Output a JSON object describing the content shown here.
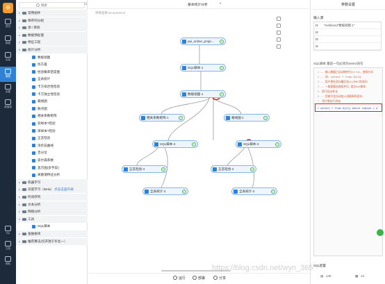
{
  "rail": [
    {
      "label": "首页"
    },
    {
      "label": "数据"
    },
    {
      "label": "实验"
    },
    {
      "label": "模型"
    },
    {
      "label": "设置"
    },
    {
      "label": "数据源"
    },
    {
      "label": "PAI"
    },
    {
      "label": "文档"
    },
    {
      "label": "帮助"
    }
  ],
  "tree": {
    "search_placeholder": "搜索",
    "rows": [
      {
        "type": "group",
        "label": "常用组件"
      },
      {
        "type": "group",
        "label": "保存的分组"
      },
      {
        "type": "group",
        "label": "源 / 目标"
      },
      {
        "type": "group",
        "label": "数据预处理"
      },
      {
        "type": "group",
        "label": "特征工程"
      },
      {
        "type": "group-open",
        "label": "统计分析"
      },
      {
        "type": "leaf",
        "label": "数据视图"
      },
      {
        "type": "leaf",
        "label": "协方差"
      },
      {
        "type": "leaf",
        "label": "经验概率密度图"
      },
      {
        "type": "leaf",
        "label": "全表统计"
      },
      {
        "type": "leaf",
        "label": "卡方拟合性检验"
      },
      {
        "type": "leaf",
        "label": "卡方独立性检验"
      },
      {
        "type": "leaf",
        "label": "箱线图"
      },
      {
        "type": "leaf",
        "label": "散点图"
      },
      {
        "type": "leaf",
        "label": "相关系数矩阵"
      },
      {
        "type": "leaf",
        "label": "双样本T检验"
      },
      {
        "type": "leaf",
        "label": "单样本T检验"
      },
      {
        "type": "leaf",
        "label": "正态检验"
      },
      {
        "type": "leaf",
        "label": "洛伦兹曲线"
      },
      {
        "type": "leaf",
        "label": "百分位"
      },
      {
        "type": "leaf",
        "label": "皮尔森系数"
      },
      {
        "type": "leaf",
        "label": "直方图(多字段)"
      },
      {
        "type": "leaf",
        "label": "离散值特征分析"
      },
      {
        "type": "group",
        "label": "机器学习"
      },
      {
        "type": "group",
        "label": "深度学习（Beta）",
        "badge": "点击这里开通"
      },
      {
        "type": "group",
        "label": "时间序列"
      },
      {
        "type": "group",
        "label": "文本分析"
      },
      {
        "type": "group",
        "label": "网络分析"
      },
      {
        "type": "group-open",
        "label": "工具"
      },
      {
        "type": "leaf",
        "label": "SQL脚本"
      },
      {
        "type": "group",
        "label": "金融板块"
      },
      {
        "type": "group",
        "label": "推荐算法(仅开放于华北一）"
      }
    ]
  },
  "canvas": {
    "title": "基本统计分析",
    "crumb": "项目名称 Ecommerce",
    "nodes": [
      {
        "label": "pai_online_proje...",
        "status": "done"
      },
      {
        "label": "SQL脚本-1",
        "status": "done"
      },
      {
        "label": "数据视图-1",
        "status": "done"
      },
      {
        "label": "相关系数矩阵-1",
        "status": "done"
      },
      {
        "label": "箱线图-1",
        "status": "done"
      },
      {
        "label": "SQL脚本-3",
        "status": "done"
      },
      {
        "label": "SQL脚本-3",
        "status": "done"
      },
      {
        "label": "正态检验-2",
        "status": "done"
      },
      {
        "label": "正态检验-2",
        "status": "done"
      },
      {
        "label": "全表统计-2",
        "status": "done"
      },
      {
        "label": "全表统计-2",
        "status": "done"
      }
    ],
    "buttons": {
      "run": "运行",
      "deploy": "部署",
      "share": "分享"
    }
  },
  "props": {
    "header": "参数设置",
    "input_label": "输入源",
    "inputs": [
      {
        "no": "t1",
        "val": "\"mahbond\"数据视图-1\""
      },
      {
        "no": "t2",
        "val": ""
      },
      {
        "no": "t3",
        "val": ""
      },
      {
        "no": "t4",
        "val": ""
      }
    ],
    "sql_hint": "SQL脚本 最后一句必须为select语句",
    "code_lines": [
      {
        "no": "1",
        "kind": "cm",
        "text": "-- 输入数据已自动映射为t1~t4, 使用方式"
      },
      {
        "no": "2",
        "kind": "cm",
        "text": "-- 如: select * from ${t1}"
      },
      {
        "no": "3",
        "kind": "cm",
        "text": "-- 用户需在语句最后加入LIMIT的语句"
      },
      {
        "no": "4",
        "kind": "cm",
        "text": "-- 一般需要连接组件后,语法sql脚本"
      },
      {
        "no": "5",
        "kind": "cm",
        "text": "   即可自动补全"
      },
      {
        "no": "6",
        "kind": "cm",
        "text": "-- 目前不会自动加入创建表的语句,"
      },
      {
        "no": "7",
        "kind": "cm",
        "text": "   用户需自行添加"
      },
      {
        "no": "8",
        "kind": "cd",
        "text": "select * from ${t1} where region = 4"
      }
    ],
    "sqlcfg": "SQL配置",
    "foot": {
      "a": "140",
      "b": "14"
    }
  },
  "watermark": "https://blog.csdn.net/wyn_365"
}
